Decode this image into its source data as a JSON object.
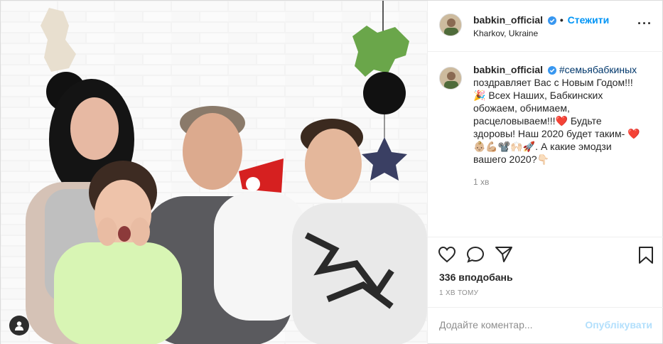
{
  "header": {
    "username": "babkin_official",
    "follow_label": "Стежити",
    "location": "Kharkov, Ukraine"
  },
  "caption": {
    "username": "babkin_official",
    "hashtag": "#семьябабкиных",
    "line1": "поздравляет Вас с Новым Годом!!! 🎉",
    "line2": "Всех Наших, Бабкинских обожаем, обнимаем, расцеловываем!!!❤️",
    "line3": "Будьте здоровы! Наш 2020 будет таким- ❤️",
    "line4": "👶🏼💪🏼📽️🙌🏻🚀. А какие эмодзи вашего 2020?👇🏻",
    "time": "1 хв"
  },
  "actions": {
    "likes": "336 вподобань",
    "ago": "1 ХВ ТОМУ"
  },
  "comment": {
    "placeholder": "Додайте коментар...",
    "post_label": "Опублікувати"
  },
  "colors": {
    "accent": "#0095f6",
    "disabled_accent": "#b2dffc",
    "muted": "#8e8e8e",
    "border": "#efefef",
    "text": "#262626"
  },
  "icons": [
    "verified-icon",
    "more-icon",
    "heart-icon",
    "comment-icon",
    "share-icon",
    "bookmark-icon",
    "user-tag-icon"
  ]
}
